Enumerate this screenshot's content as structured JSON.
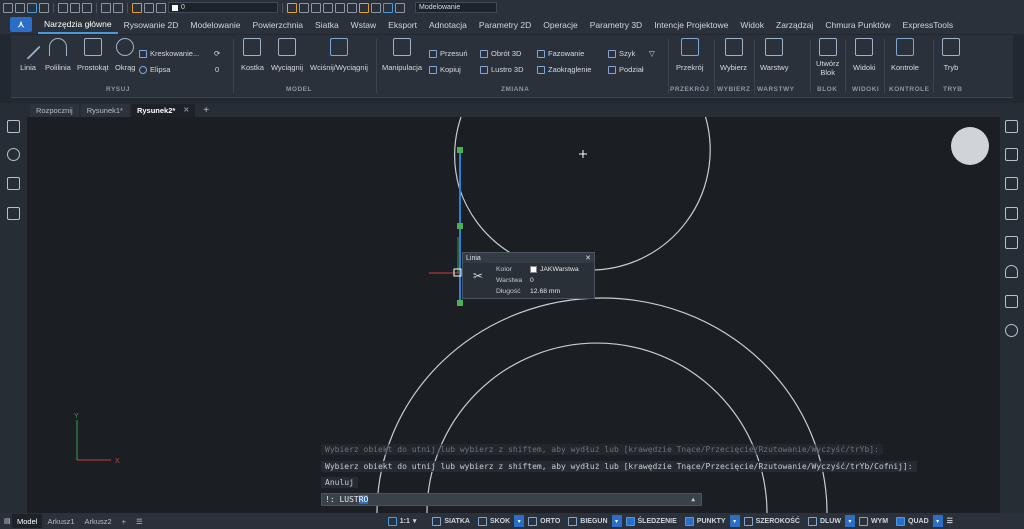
{
  "quick_access": {
    "layer_name": "0",
    "workspace": "Modelowanie"
  },
  "menu": {
    "items": [
      "Narzędzia główne",
      "Rysowanie 2D",
      "Modelowanie",
      "Powierzchnia",
      "Siatka",
      "Wstaw",
      "Eksport",
      "Adnotacja",
      "Parametry 2D",
      "Operacje",
      "Parametry 3D",
      "Intencje Projektowe",
      "Widok",
      "Zarządzaj",
      "Chmura Punktów",
      "ExpressTools"
    ]
  },
  "ribbon": {
    "rysuj": {
      "label": "RYSUJ",
      "linia": "Linia",
      "polilinia": "Polilinia",
      "prostokat": "Prostokąt",
      "okrag": "Okrąg",
      "kreskowanie": "Kreskowanie...",
      "elipsa": "Elipsa",
      "zero": "0"
    },
    "model": {
      "label": "MODEL",
      "kostka": "Kostka",
      "wyciagnij": "Wyciągnij",
      "wcisnij": "Wciśnij/Wyciągnij"
    },
    "zmiana": {
      "label": "ZMIANA",
      "manipulacja": "Manipulacja",
      "przesun": "Przesuń",
      "kopiuj": "Kopiuj",
      "obrot3d": "Obrót 3D",
      "lustro3d": "Lustro 3D",
      "fazowanie": "Fazowanie",
      "zaokraglenie": "Zaokrąglenie",
      "szyk": "Szyk",
      "podzial": "Podział"
    },
    "przekroj": {
      "label": "PRZEKRÓJ",
      "btn": "Przekrój"
    },
    "wybierz": {
      "label": "WYBIERZ",
      "btn": "Wybierz"
    },
    "warstwy": {
      "label": "WARSTWY",
      "btn": "Warstwy"
    },
    "blok": {
      "label": "BLOK",
      "btn1": "Utwórz",
      "btn2": "Blok"
    },
    "widoki": {
      "label": "WIDOKI",
      "btn": "Widoki"
    },
    "kontrole": {
      "label": "KONTROLE",
      "btn": "Kontrole"
    },
    "tryb": {
      "label": "TRYB",
      "btn": "Tryb"
    }
  },
  "doc_tabs": [
    "Rozpocznij",
    "Rysunek1*",
    "Rysunek2*"
  ],
  "ucs": {
    "x": "X",
    "y": "Y"
  },
  "properties_popup": {
    "title": "Linia",
    "rows": [
      {
        "label": "Kolor",
        "value": "JAKWarstwa"
      },
      {
        "label": "Warstwa",
        "value": "0"
      },
      {
        "label": "Długość",
        "value": "12.68 mm"
      }
    ]
  },
  "command": {
    "history": [
      "Wybierz obiekt do utnij lub wybierz z shiftem, aby wydłuż lub [krawędzie Tnące/Przecięcie/Rzutowanie/Wyczyść/trYb]:",
      "Wybierz obiekt do utnij lub wybierz z shiftem, aby wydłuż lub [krawędzie Tnące/Przecięcie/Rzutowanie/Wyczyść/trYb/Cofnij]:",
      "Anuluj"
    ],
    "prompt": "!: LUST",
    "selected": "RO"
  },
  "status": {
    "layout_tabs": [
      "Model",
      "Arkusz1",
      "Arkusz2"
    ],
    "scale": "1:1",
    "toggles": [
      {
        "label": "SIATKA",
        "on": false
      },
      {
        "label": "SKOK",
        "on": false
      },
      {
        "label": "ORTO",
        "on": false
      },
      {
        "label": "BIEGUN",
        "on": false
      },
      {
        "label": "ŚLEDZENIE",
        "on": true
      },
      {
        "label": "PUNKTY",
        "on": true
      },
      {
        "label": "SZEROKOŚĆ",
        "on": false
      },
      {
        "label": "DLUW",
        "on": false
      },
      {
        "label": "WYM",
        "on": false
      },
      {
        "label": "QUAD",
        "on": true
      }
    ]
  },
  "colors": {
    "accent": "#2b6ec7",
    "background": "#1b1e23",
    "selected_line": "#2f7fd6",
    "grip": "#4caf50"
  }
}
